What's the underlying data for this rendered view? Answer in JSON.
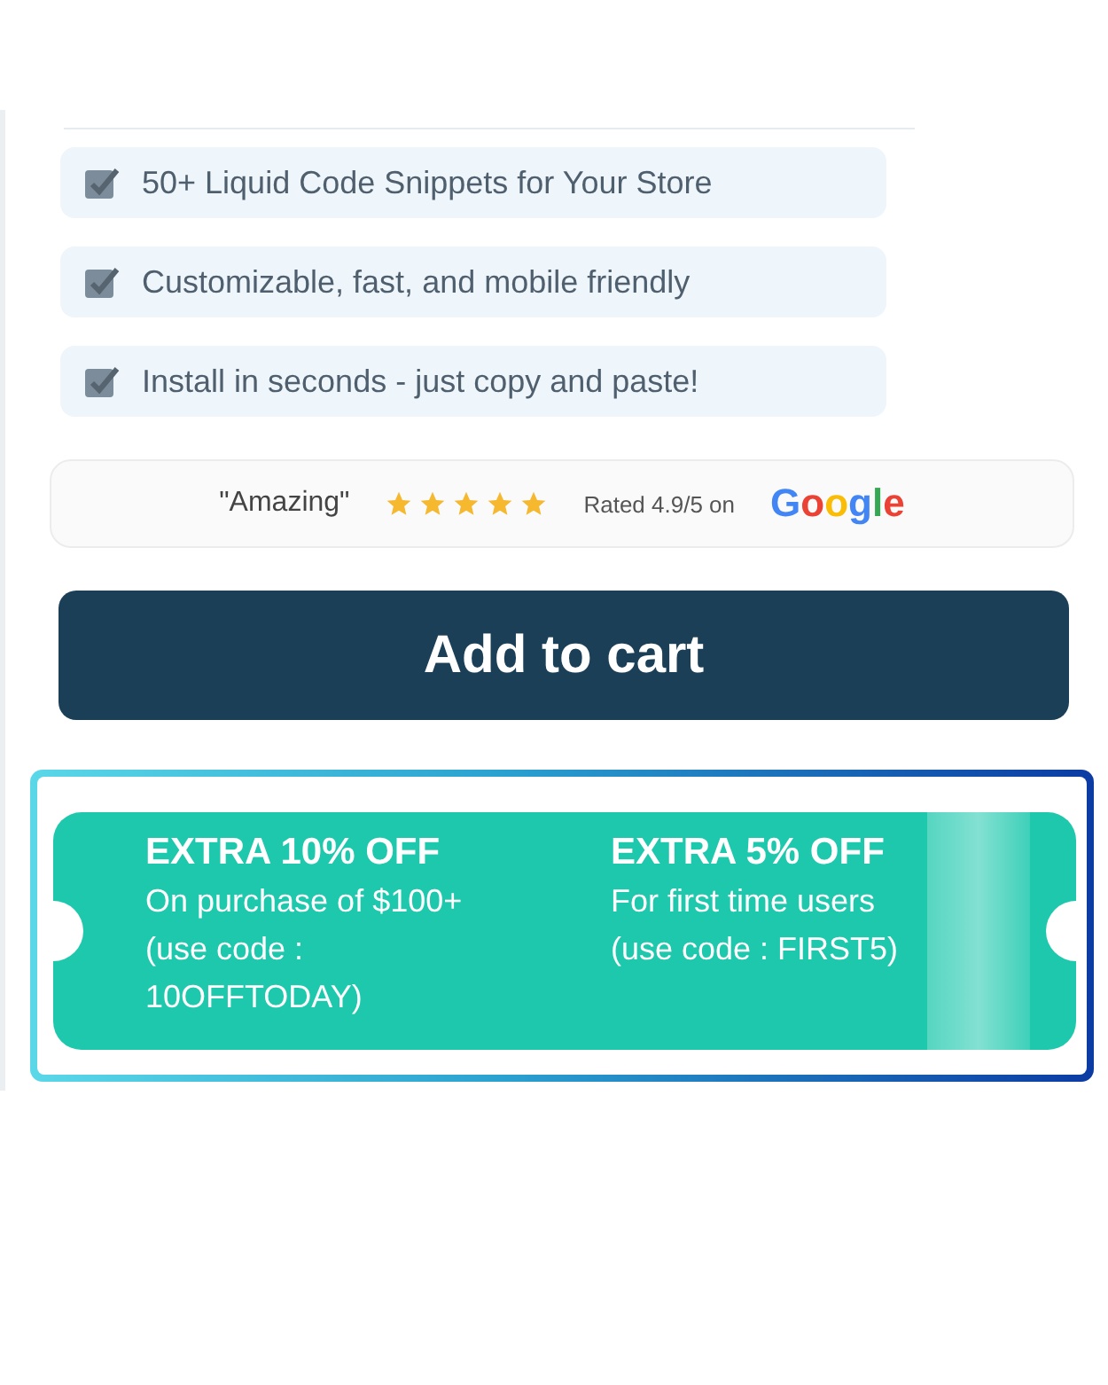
{
  "features": [
    {
      "text": "50+ Liquid Code Snippets for Your Store"
    },
    {
      "text": "Customizable, fast, and mobile friendly"
    },
    {
      "text": "Install in seconds - just copy and paste!"
    }
  ],
  "review": {
    "quote": "\"Amazing\"",
    "stars": 5,
    "rating": "Rated 4.9/5 on",
    "brand": "Google"
  },
  "add_to_cart": "Add to cart",
  "offers": [
    {
      "headline": "EXTRA 10% OFF",
      "lines": [
        "On purchase of $100+",
        "(use code :",
        "10OFFTODAY)"
      ]
    },
    {
      "headline": "EXTRA 5% OFF",
      "lines": [
        "For first time users",
        "(use code : FIRST5)"
      ]
    }
  ]
}
